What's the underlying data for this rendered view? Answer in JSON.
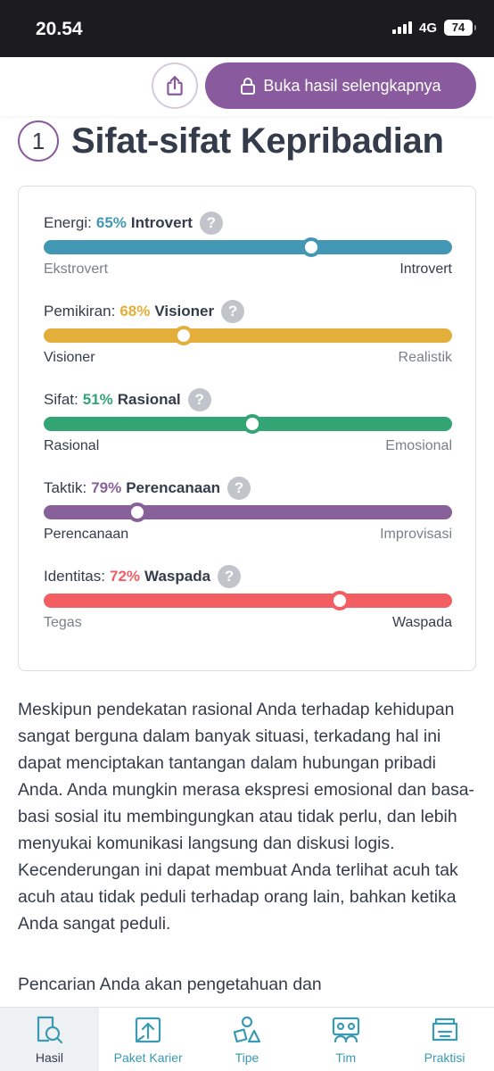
{
  "status": {
    "time": "20.54",
    "network": "4G",
    "battery": "74"
  },
  "topbar": {
    "unlock_label": "Buka hasil selengkapnya"
  },
  "section": {
    "number": "1",
    "title": "Sifat-sifat Kepribadian"
  },
  "traits": [
    {
      "label": "Energi:",
      "percent": "65%",
      "name": "Introvert",
      "left": "Ekstrovert",
      "right": "Introvert",
      "strong_side": "right",
      "color": "#4298b4",
      "pct_color": "#4298b4",
      "value": 0.655
    },
    {
      "label": "Pemikiran:",
      "percent": "68%",
      "name": "Visioner",
      "left": "Visioner",
      "right": "Realistik",
      "strong_side": "left",
      "color": "#e4ae3a",
      "pct_color": "#e4ae3a",
      "value": 0.343
    },
    {
      "label": "Sifat:",
      "percent": "51%",
      "name": "Rasional",
      "left": "Rasional",
      "right": "Emosional",
      "strong_side": "left",
      "color": "#33a474",
      "pct_color": "#33a474",
      "value": 0.51
    },
    {
      "label": "Taktik:",
      "percent": "79%",
      "name": "Perencanaan",
      "left": "Perencanaan",
      "right": "Improvisasi",
      "strong_side": "left",
      "color": "#88619a",
      "pct_color": "#88619a",
      "value": 0.23
    },
    {
      "label": "Identitas:",
      "percent": "72%",
      "name": "Waspada",
      "left": "Tegas",
      "right": "Waspada",
      "strong_side": "right",
      "color": "#f25e62",
      "pct_color": "#f25e62",
      "value": 0.725
    }
  ],
  "paragraphs": [
    "Meskipun pendekatan rasional Anda terhadap kehidupan sangat berguna dalam banyak situasi, terkadang hal ini dapat menciptakan tantangan dalam hubungan pribadi Anda. Anda mungkin merasa ekspresi emosional dan basa-basi sosial itu membingungkan atau tidak perlu, dan lebih menyukai komunikasi langsung dan diskusi logis. Kecenderungan ini dapat membuat Anda terlihat acuh tak acuh atau tidak peduli terhadap orang lain, bahkan ketika Anda sangat peduli.",
    "Pencarian Anda akan pengetahuan dan"
  ],
  "nav": [
    {
      "label": "Hasil",
      "icon": "search-doc-icon",
      "active": true
    },
    {
      "label": "Paket Karier",
      "icon": "career-upload-icon",
      "active": false
    },
    {
      "label": "Tipe",
      "icon": "shapes-icon",
      "active": false
    },
    {
      "label": "Tim",
      "icon": "team-icon",
      "active": false
    },
    {
      "label": "Praktisi",
      "icon": "folder-icon",
      "active": false
    }
  ]
}
